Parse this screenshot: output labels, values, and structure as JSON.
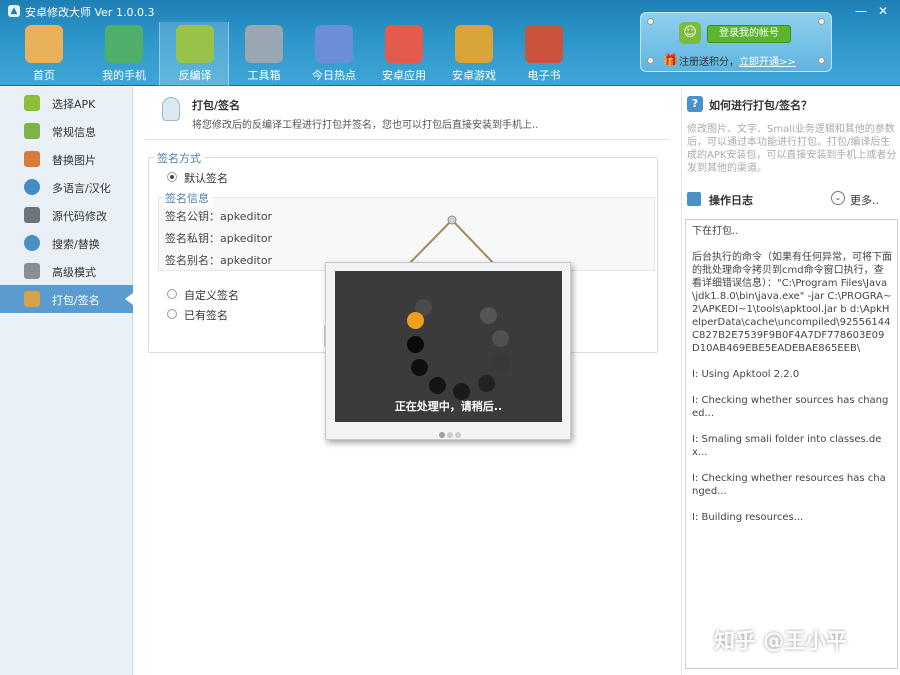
{
  "window": {
    "title": "安卓修改大师 Ver 1.0.0.3",
    "minimize": "—",
    "close": "✕"
  },
  "nav": [
    {
      "label": "首页",
      "icon": "house-icon",
      "color": "#e9b25a"
    },
    {
      "label": "我的手机",
      "icon": "radar-icon",
      "color": "#4fae6a"
    },
    {
      "label": "反编译",
      "icon": "android-icon",
      "color": "#98c24a",
      "active": true
    },
    {
      "label": "工具箱",
      "icon": "toolbox-icon",
      "color": "#9aa7b2"
    },
    {
      "label": "今日热点",
      "icon": "star-icon",
      "color": "#6b8fd6"
    },
    {
      "label": "安卓应用",
      "icon": "apps-grid-icon",
      "color": "#e45b4d"
    },
    {
      "label": "安卓游戏",
      "icon": "game-icon",
      "color": "#d9a43a"
    },
    {
      "label": "电子书",
      "icon": "books-icon",
      "color": "#c9533c"
    }
  ],
  "login": {
    "button": "登录我的帐号",
    "register_text": "注册送积分，",
    "register_link": "立即开通>>"
  },
  "sidebar": [
    {
      "label": "选择APK",
      "icon": "android-icon",
      "color": "#8fbf3a"
    },
    {
      "label": "常规信息",
      "icon": "android-gear-icon",
      "color": "#7fb24a"
    },
    {
      "label": "替换图片",
      "icon": "image-icon",
      "color": "#d97b3a"
    },
    {
      "label": "多语言/汉化",
      "icon": "globe-icon",
      "color": "#3f8ec9"
    },
    {
      "label": "源代码修改",
      "icon": "code-icon",
      "color": "#6a747c"
    },
    {
      "label": "搜索/替换",
      "icon": "search-icon",
      "color": "#4a8fc2"
    },
    {
      "label": "高级模式",
      "icon": "tools-icon",
      "color": "#8a8f93"
    },
    {
      "label": "打包/签名",
      "icon": "package-icon",
      "color": "#d8a24a",
      "active": true
    }
  ],
  "main": {
    "title": "打包/签名",
    "description": "将您修改后的反编译工程进行打包并签名，您也可以打包后直接安装到手机上..",
    "sign_legend": "签名方式",
    "default_sign": "默认签名",
    "info_legend": "签名信息",
    "info_rows": [
      "签名公钥：apkeditor",
      "签名私钥：apkeditor",
      "签名别名：apkeditor"
    ],
    "custom_sign": "自定义签名",
    "existing_sign": "已有签名"
  },
  "loader": {
    "text": "正在处理中，请稍后.."
  },
  "right": {
    "help_title": "如何进行打包/签名？",
    "help_desc": "修改图片、文字、Smali业务逻辑和其他的参数后，可以通过本功能进行打包。打包/编译后生成的APK安装包，可以直接安装到手机上或者分发到其他的渠道。",
    "log_title": "操作日志",
    "more": "更多..",
    "log_lines": [
      "下在打包..",
      "",
      "后台执行的命令（如果有任何异常，可将下面的批处理命令拷贝到cmd命令窗口执行，查看详细错误信息）：\"C:\\Program Files\\Java\\jdk1.8.0\\bin\\java.exe\" -jar C:\\PROGRA~2\\APKEDI~1\\tools\\apktool.jar b d:\\ApkHelperData\\cache\\uncompiled\\92556144C827B2E7539F9B0F4A7DF778603E09D10AB469EBE5EADEBAE865EEB\\",
      "",
      "I: Using Apktool 2.2.0",
      "",
      "I: Checking whether sources has changed...",
      "",
      "I: Smaling smali folder into classes.dex...",
      "",
      "I: Checking whether resources has changed...",
      "",
      "I: Building resources..."
    ],
    "watermark": "知乎 @王小平"
  }
}
